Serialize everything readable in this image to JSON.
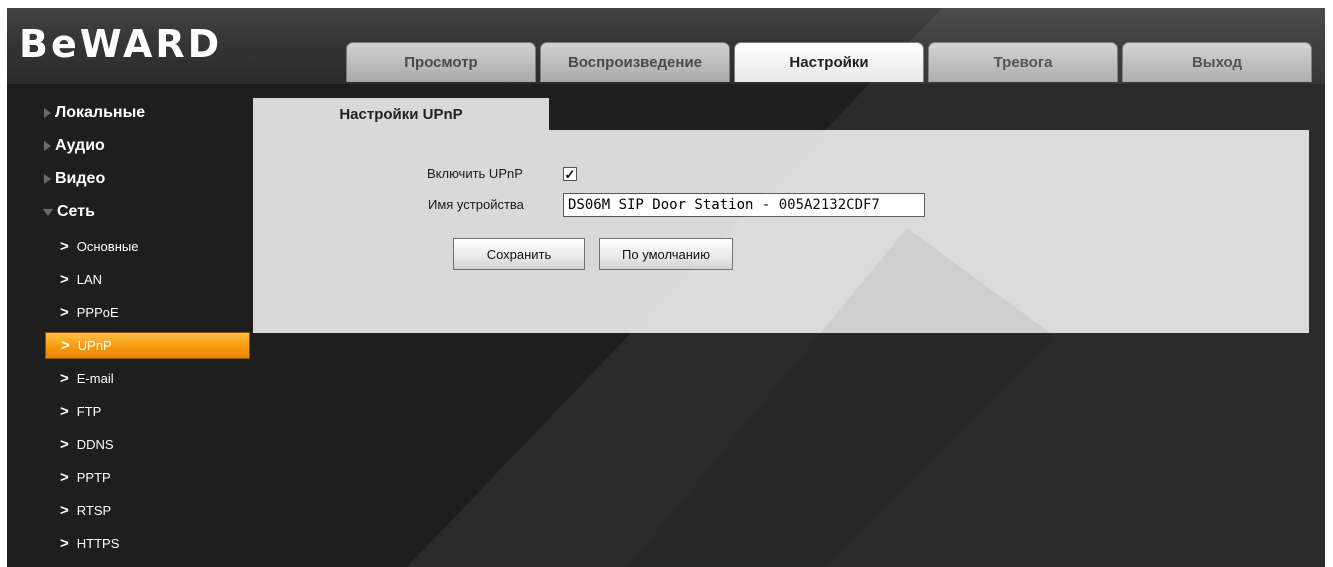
{
  "brand": {
    "logo": "BeWARD"
  },
  "nav": {
    "tabs": [
      "Просмотр",
      "Воспроизведение",
      "Настройки",
      "Тревога",
      "Выход"
    ],
    "active_tab": "Настройки"
  },
  "sidebar": {
    "sections": [
      "Локальные",
      "Аудио",
      "Видео",
      "Сеть"
    ],
    "expanded_section": "Сеть",
    "network_items": [
      "Основные",
      "LAN",
      "PPPoE",
      "UPnP",
      "E-mail",
      "FTP",
      "DDNS",
      "PPTP",
      "RTSP",
      "HTTPS"
    ],
    "active_item": "UPnP"
  },
  "content": {
    "tab_title": "Настройки UPnP",
    "enable_label": "Включить UPnP",
    "enable_checked": true,
    "device_name_label": "Имя устройства",
    "device_name_value": "DS06M SIP Door Station - 005A2132CDF7",
    "save_button": "Сохранить",
    "default_button": "По умолчанию"
  },
  "icons": {
    "checkmark": "check-icon",
    "section_arrow": "triangle-right-icon",
    "expanded_arrow": "triangle-down-icon",
    "sub_chevron": "chevron-right-icon"
  },
  "colors": {
    "background": "#1e1e1e",
    "panel": "#d9d9d9",
    "active_item": "#f59a0e",
    "header": "#383838"
  }
}
